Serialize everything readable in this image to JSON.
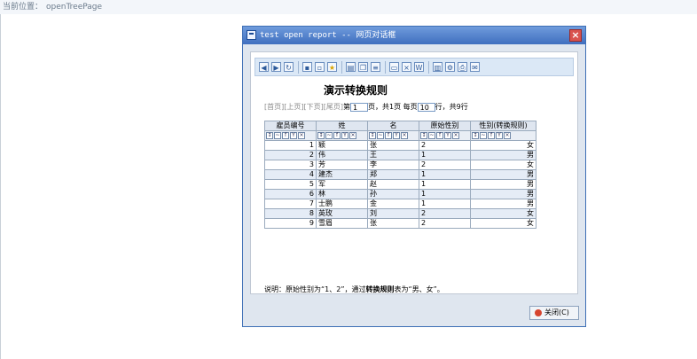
{
  "breadcrumb": {
    "label": "当前位置：",
    "page": "openTreePage"
  },
  "dialog": {
    "title": "test open report -- 网页对话框",
    "close_button": "关闭(C)"
  },
  "toolbar": {
    "buttons": [
      "back-icon",
      "forward-icon",
      "refresh-icon",
      "save-icon",
      "save-as-icon",
      "favorite-icon",
      "export-icon",
      "copy-icon",
      "format-icon",
      "print-preview-icon",
      "export-excel-icon",
      "export-word-icon",
      "chart-icon",
      "settings-icon",
      "print-icon",
      "mail-icon"
    ]
  },
  "report": {
    "title": "演示转换规则",
    "pager": {
      "first": "[首页]",
      "prev": "[上页]",
      "next": "[下页]",
      "last": "[尾页]",
      "page_prefix": "第",
      "page_value": "1",
      "page_suffix": "页，共1页",
      "per_page_prefix": "每页",
      "per_page_value": "10",
      "per_page_suffix": "行，共9行"
    },
    "columns": [
      "雇员编号",
      "姓",
      "名",
      "原始性别",
      "性别(转换规则)"
    ],
    "rows": [
      [
        "1",
        "颖",
        "张",
        "2",
        "女"
      ],
      [
        "2",
        "伟",
        "王",
        "1",
        "男"
      ],
      [
        "3",
        "芳",
        "李",
        "2",
        "女"
      ],
      [
        "4",
        "建杰",
        "郑",
        "1",
        "男"
      ],
      [
        "5",
        "军",
        "赵",
        "1",
        "男"
      ],
      [
        "6",
        "林",
        "孙",
        "1",
        "男"
      ],
      [
        "7",
        "士鹏",
        "金",
        "1",
        "男"
      ],
      [
        "8",
        "英玫",
        "刘",
        "2",
        "女"
      ],
      [
        "9",
        "雪眉",
        "张",
        "2",
        "女"
      ]
    ],
    "note": {
      "prefix": "说明：原始性别为“1、2”，通过",
      "bold": "转换规则",
      "suffix": "表为“男、女”。"
    }
  }
}
